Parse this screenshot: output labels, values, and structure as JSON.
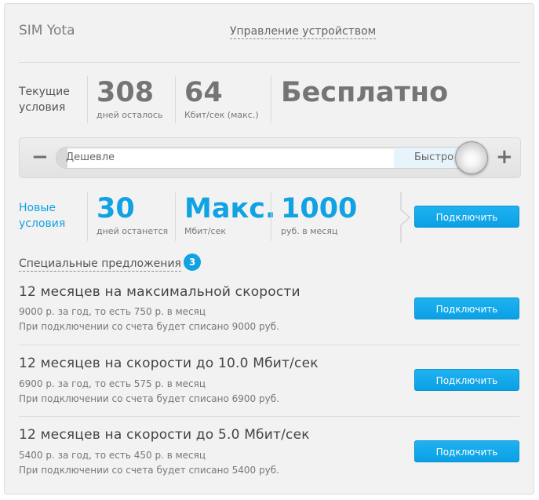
{
  "header": {
    "device_name": "SIM Yota",
    "manage_link": "Управление устройством"
  },
  "current": {
    "label_line1": "Текущие",
    "label_line2": "условия",
    "days_value": "308",
    "days_label": "дней осталось",
    "speed_value": "64",
    "speed_label": "Кбит/сек (макс.)",
    "price_value": "Бесплатно"
  },
  "slider": {
    "minus": "−",
    "plus": "+",
    "cheap_label": "Дешевле",
    "fast_label": "Быстро",
    "position": 1.0
  },
  "new": {
    "label_line1": "Новые",
    "label_line2": "условия",
    "days_value": "30",
    "days_label": "дней останется",
    "speed_value": "Макс.",
    "speed_label": "Мбит/сек",
    "price_value": "1000",
    "price_label": "руб. в месяц",
    "connect_label": "Подключить"
  },
  "special": {
    "title": "Специальные предложения",
    "count": "3",
    "offers": [
      {
        "title": "12 месяцев на максимальной скорости",
        "line1": "9000 р. за год, то есть 750 р. в месяц",
        "line2": "При подключении со счета будет списано 9000 руб.",
        "button": "Подключить"
      },
      {
        "title": "12 месяцев на скорости до 10.0 Мбит/сек",
        "line1": "6900 р. за год, то есть 575 р. в месяц",
        "line2": "При подключении со счета будет списано 6900 руб.",
        "button": "Подключить"
      },
      {
        "title": "12 месяцев на скорости до 5.0 Мбит/сек",
        "line1": "5400 р. за год, то есть 450 р. в месяц",
        "line2": "При подключении со счета будет списано 5400 руб.",
        "button": "Подключить"
      }
    ]
  },
  "colors": {
    "accent": "#10a2e3",
    "button": "#12a6e8",
    "muted_text": "#757575"
  }
}
